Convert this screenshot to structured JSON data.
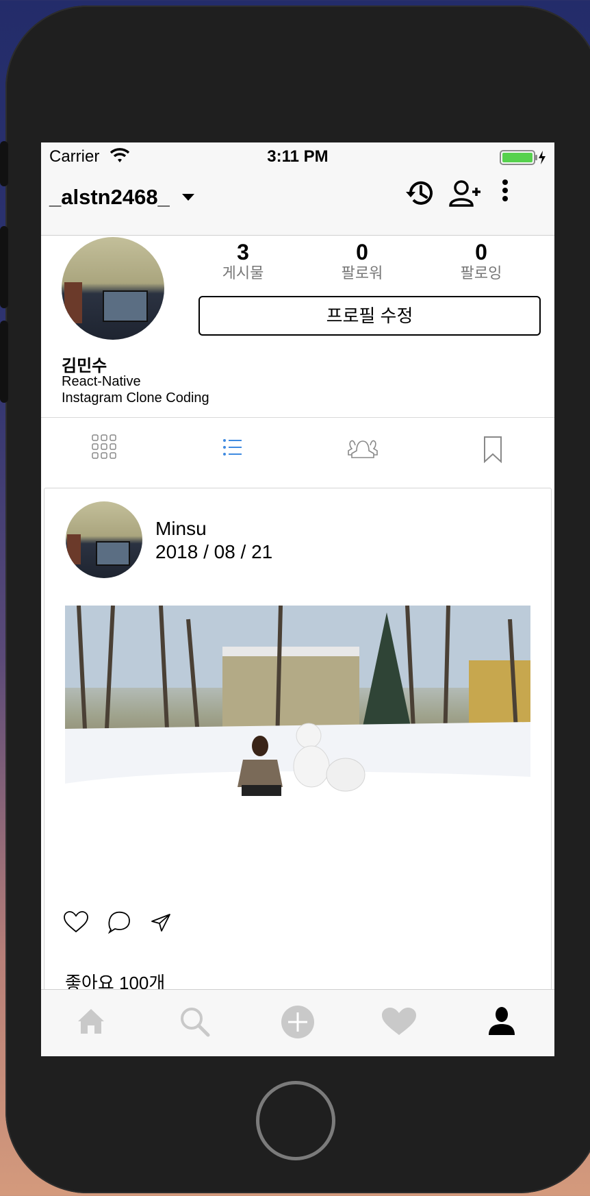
{
  "status_bar": {
    "carrier": "Carrier",
    "time": "3:11 PM"
  },
  "header": {
    "username": "_alstn2468_"
  },
  "profile": {
    "stats": [
      {
        "count": "3",
        "label": "게시물"
      },
      {
        "count": "0",
        "label": "팔로워"
      },
      {
        "count": "0",
        "label": "팔로잉"
      }
    ],
    "edit_button": "프로필 수정",
    "name": "김민수",
    "bio_line1": "React-Native",
    "bio_line2": "Instagram Clone Coding"
  },
  "tabs": {
    "active": "list-icon",
    "accent": "#3f8ae0"
  },
  "post": {
    "username": "Minsu",
    "date": "2018 / 08 / 21",
    "likes": "좋아요 100개"
  },
  "bottom_nav": [
    "home-icon",
    "search-icon",
    "add-icon",
    "heart-icon",
    "profile-icon"
  ]
}
